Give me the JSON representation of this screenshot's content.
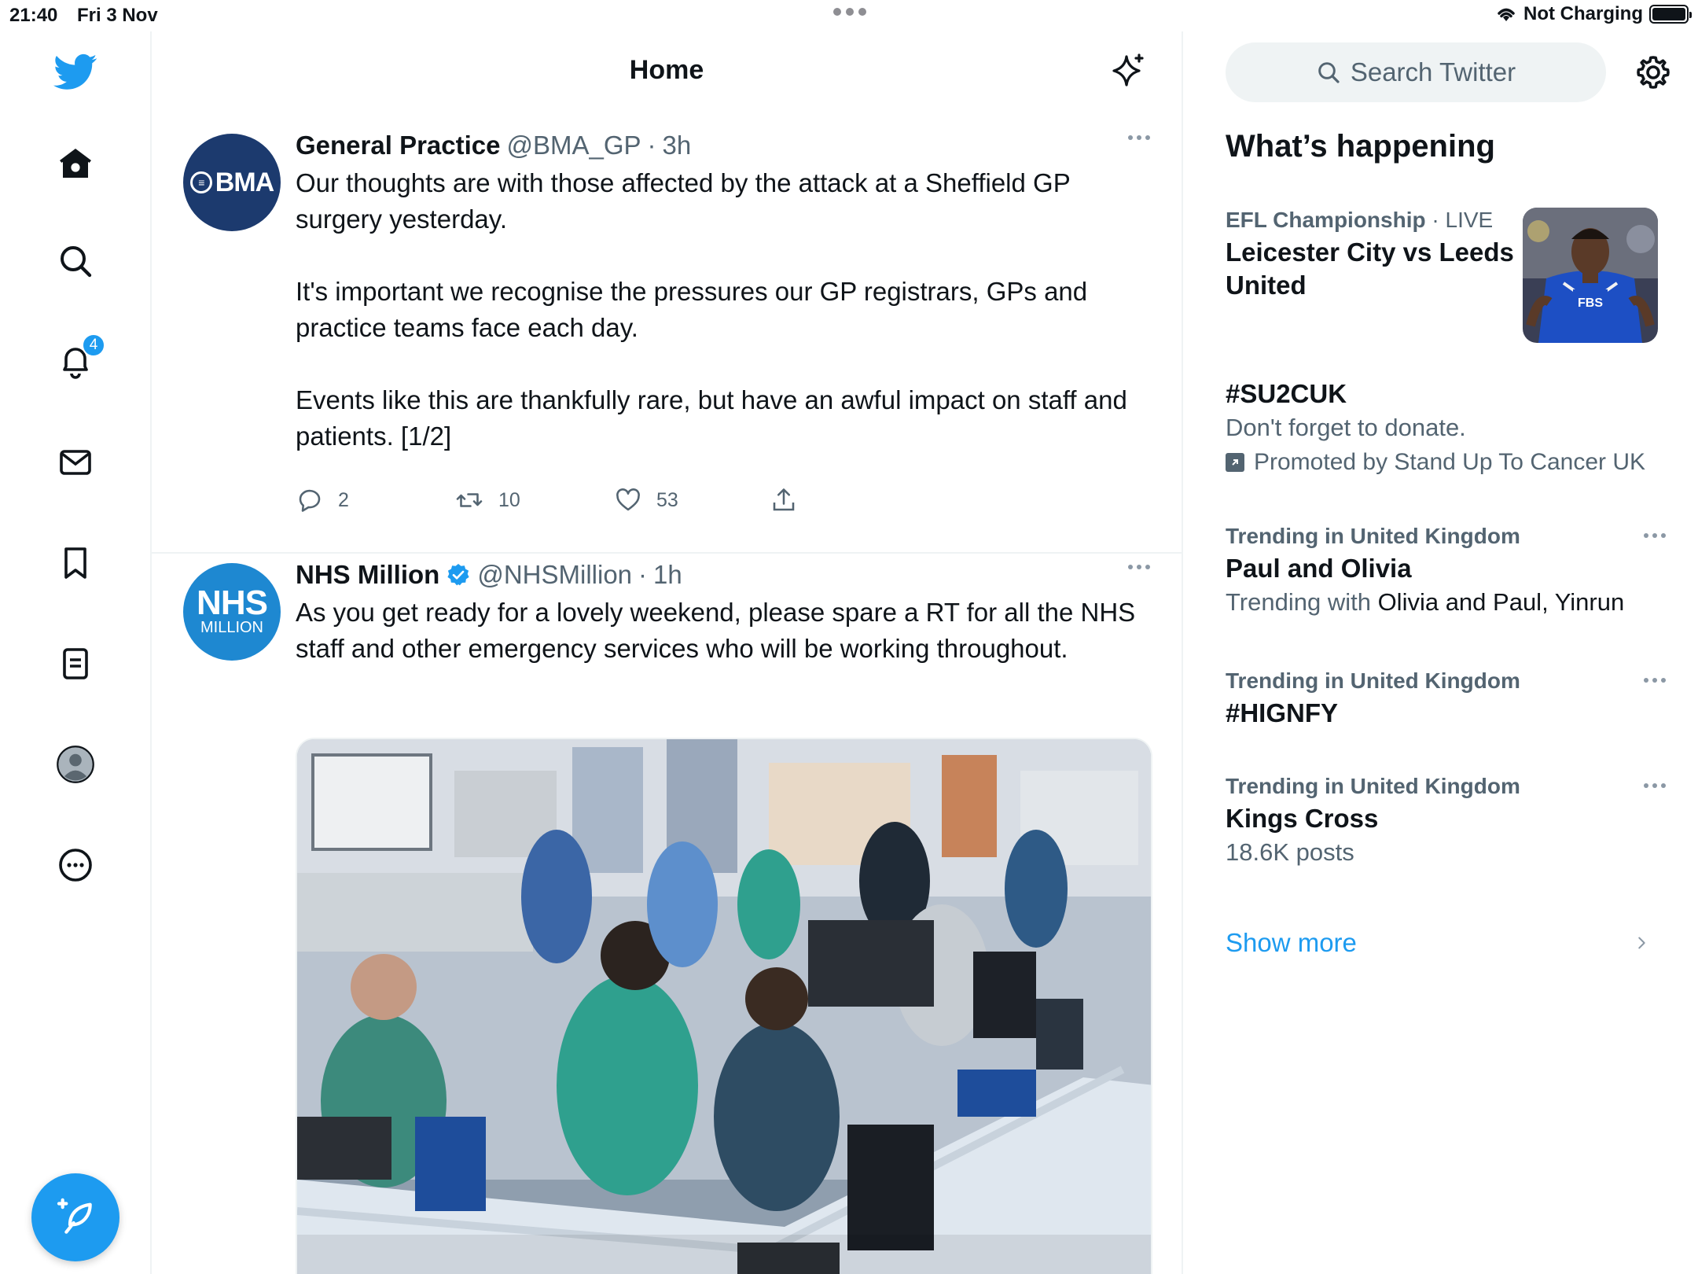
{
  "status_bar": {
    "time": "21:40",
    "date": "Fri 3 Nov",
    "network_status": "Not Charging"
  },
  "left_nav": {
    "items": [
      {
        "name": "twitter-logo-icon"
      },
      {
        "name": "home-icon"
      },
      {
        "name": "search-icon"
      },
      {
        "name": "bell-icon",
        "badge": "4"
      },
      {
        "name": "envelope-icon"
      },
      {
        "name": "bookmark-icon"
      },
      {
        "name": "lists-icon"
      },
      {
        "name": "profile-icon"
      },
      {
        "name": "more-circle-icon"
      }
    ],
    "compose_icon": "feather-plus-icon"
  },
  "header": {
    "title": "Home",
    "sparkle_icon": "sparkle-icon"
  },
  "timeline": {
    "tweets": [
      {
        "name": "General Practice",
        "handle": "@BMA_GP",
        "dot": "·",
        "time": "3h",
        "avatar_text": "BMA",
        "text": "Our thoughts are with those affected by the attack at a Sheffield GP surgery yesterday.\n\nIt's important we recognise the pressures our GP registrars, GPs and practice teams face each day.\n\nEvents like this are thankfully rare, but have an awful impact on staff and patients. [1/2]",
        "replies": "2",
        "retweets": "10",
        "likes": "53"
      },
      {
        "name": "NHS Million",
        "handle": "@NHSMillion",
        "dot": "·",
        "time": "1h",
        "verified": true,
        "avatar_text_big": "NHS",
        "avatar_text_small": "MILLION",
        "text": "As you get ready for a lovely weekend, please spare a RT for all the NHS staff and other emergency services who will be working throughout."
      }
    ]
  },
  "sidebar": {
    "search_placeholder": "Search Twitter",
    "section_title": "What’s happening",
    "trends": [
      {
        "meta": "EFL Championship",
        "meta_suffix": " · LIVE",
        "title": "Leicester City vs Leeds United",
        "image_text": "FBS"
      },
      {
        "title": "#SU2CUK",
        "subtitle": "Don't forget to donate.",
        "promoted": "Promoted by Stand Up To Cancer UK"
      },
      {
        "meta": "Trending in United Kingdom",
        "title": "Paul and Olivia",
        "subtitle_prefix": "Trending with ",
        "subtitle_strong": "Olivia and Paul, Yinrun"
      },
      {
        "meta": "Trending in United Kingdom",
        "title": "#HIGNFY"
      },
      {
        "meta": "Trending in United Kingdom",
        "title": "Kings Cross",
        "subtitle": "18.6K posts"
      }
    ],
    "show_more": "Show more"
  },
  "colors": {
    "accent": "#1d9bf0",
    "text_primary": "#0f1419",
    "text_secondary": "#536471",
    "border": "#eff3f4"
  }
}
